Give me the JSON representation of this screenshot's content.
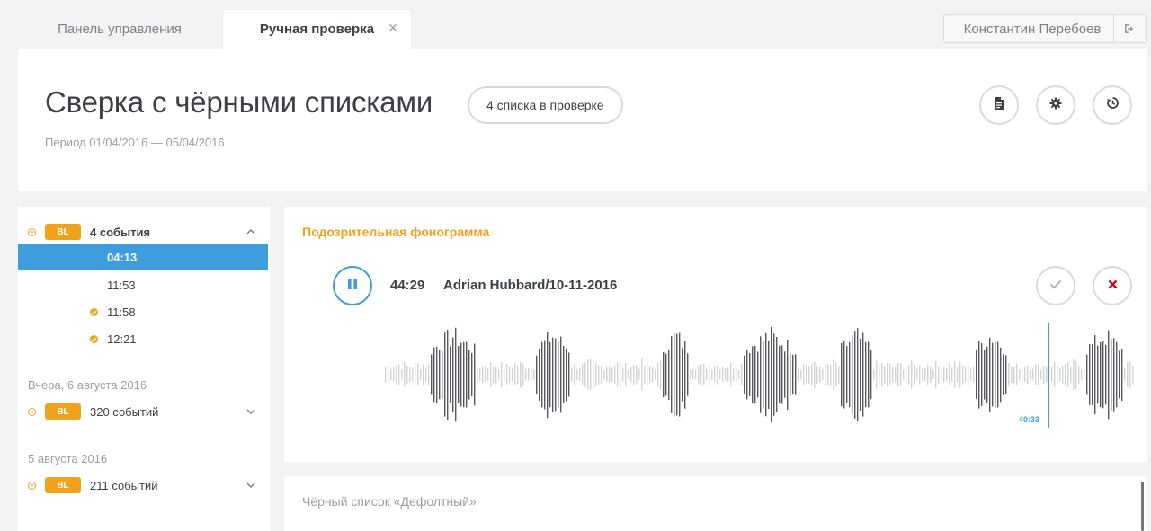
{
  "tabs": {
    "dashboard": "Панель управления",
    "manual_check": "Ручная проверка",
    "close_icon": "close-icon"
  },
  "user": {
    "name": "Константин Перебоев",
    "logout_icon": "logout-icon"
  },
  "header": {
    "title": "Сверка с чёрными списками",
    "lists_badge": "4 списка в проверке",
    "period": "Период 01/04/2016 — 05/04/2016",
    "actions": [
      "document-icon",
      "gear-icon",
      "history-icon"
    ]
  },
  "events": {
    "groups": [
      {
        "badge": "BL",
        "label": "4 события",
        "expanded": true,
        "items": [
          {
            "time": "04:13",
            "active": true,
            "checked": false
          },
          {
            "time": "11:53",
            "active": false,
            "checked": false
          },
          {
            "time": "11:58",
            "active": false,
            "checked": true
          },
          {
            "time": "12:21",
            "active": false,
            "checked": true
          }
        ]
      },
      {
        "date": "Вчера, 6 августа 2016",
        "badge": "BL",
        "label": "320 событий",
        "expanded": false
      },
      {
        "date": "5 августа 2016",
        "badge": "BL",
        "label": "211 событий",
        "expanded": false
      }
    ]
  },
  "player": {
    "title": "Подозрительная фонограмма",
    "time": "44:29",
    "file": "Adrian Hubbard/10-11-2016",
    "marker_time": "40:33",
    "progress": 0.885,
    "accept_icon": "check-icon",
    "reject_icon": "cross-icon"
  },
  "blacklist": {
    "title": "Чёрный список «Дефолтный»"
  },
  "colors": {
    "accent": "#3d9ddd",
    "warning": "#f0a21d",
    "reject": "#d0021b"
  }
}
